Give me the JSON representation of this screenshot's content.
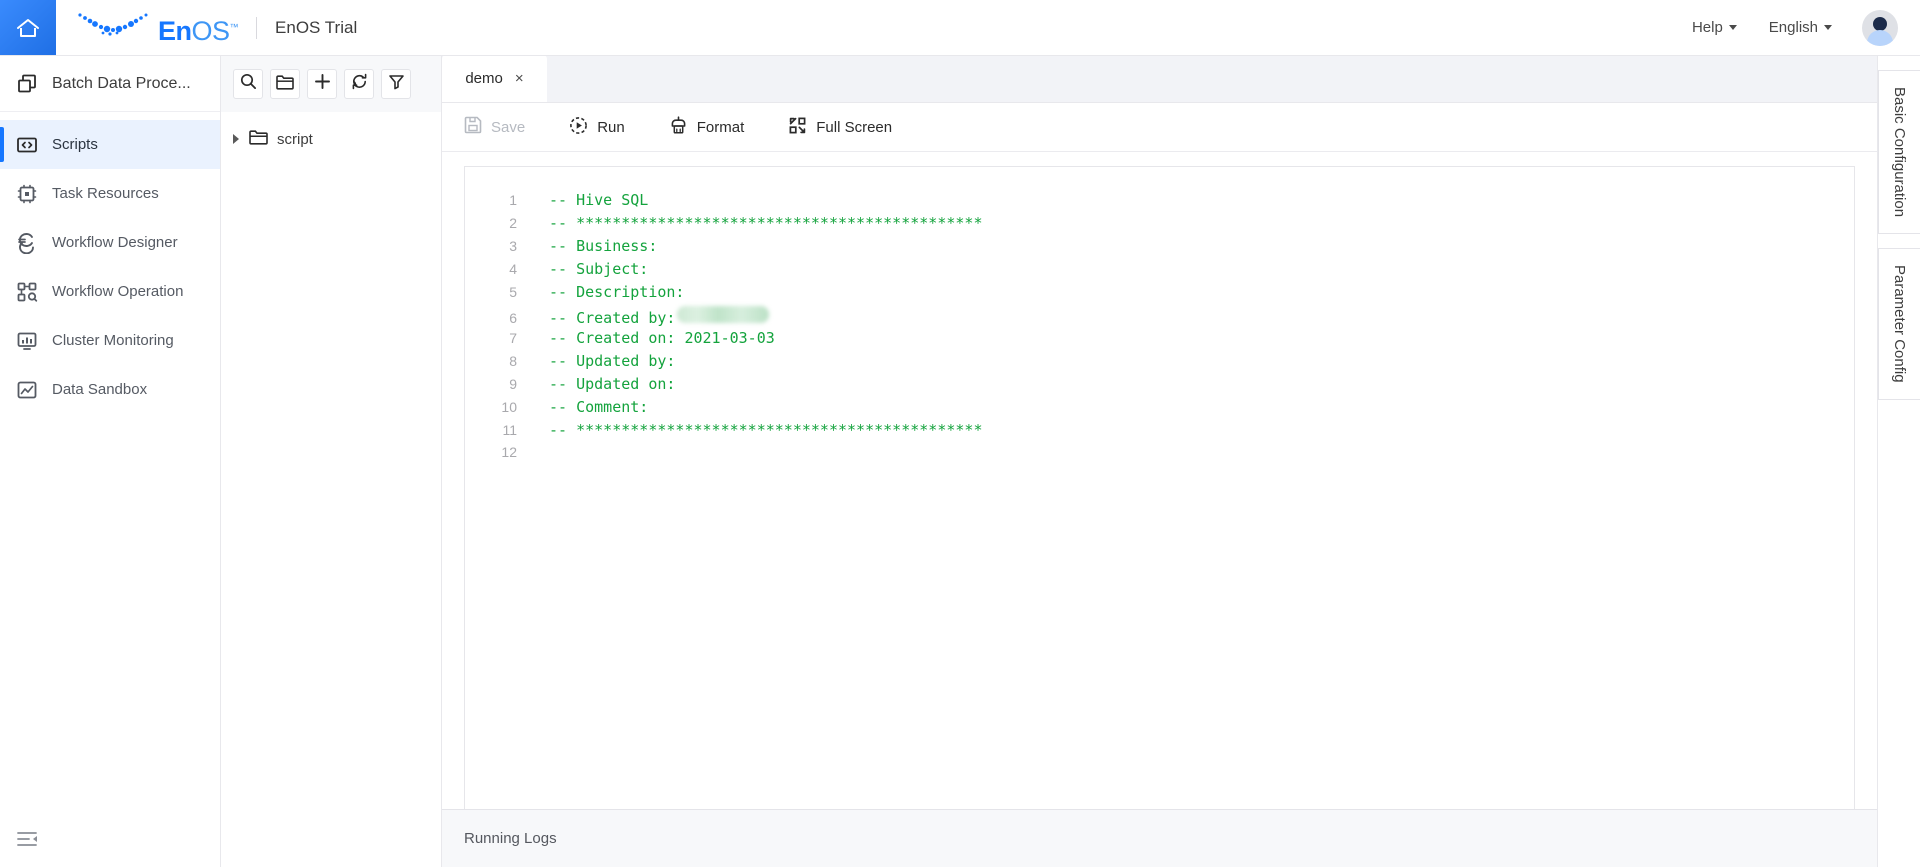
{
  "header": {
    "home_icon": "home-icon",
    "logo_en": "En",
    "logo_os": "OS",
    "logo_tm": "™",
    "product_title": "EnOS Trial",
    "help_label": "Help",
    "language_label": "English",
    "avatar": "user-avatar"
  },
  "sidebar": {
    "module_title": "Batch Data Proce...",
    "module_icon": "stack-icon",
    "collapse_icon": "collapse-sidebar-icon",
    "items": [
      {
        "label": "Scripts",
        "icon": "code-brackets-icon",
        "active": true
      },
      {
        "label": "Task Resources",
        "icon": "chip-icon",
        "active": false
      },
      {
        "label": "Workflow Designer",
        "icon": "flow-designer-icon",
        "active": false
      },
      {
        "label": "Workflow Operation",
        "icon": "flow-operation-icon",
        "active": false
      },
      {
        "label": "Cluster Monitoring",
        "icon": "monitor-chart-icon",
        "active": false
      },
      {
        "label": "Data Sandbox",
        "icon": "sandbox-icon",
        "active": false
      }
    ]
  },
  "tree": {
    "toolbar": [
      {
        "name": "search-icon",
        "title": "Search"
      },
      {
        "name": "folder-icon",
        "title": "New Folder"
      },
      {
        "name": "plus-icon",
        "title": "New"
      },
      {
        "name": "refresh-icon",
        "title": "Refresh"
      },
      {
        "name": "filter-icon",
        "title": "Filter"
      }
    ],
    "nodes": [
      {
        "label": "script",
        "expanded": false,
        "icon": "folder-icon"
      }
    ]
  },
  "editor": {
    "tabs": [
      {
        "label": "demo",
        "close": "×",
        "active": true
      }
    ],
    "toolbar": {
      "save_label": "Save",
      "save_icon": "save-icon",
      "save_disabled": true,
      "run_label": "Run",
      "run_icon": "run-icon",
      "format_label": "Format",
      "format_icon": "format-brush-icon",
      "fullscreen_label": "Full Screen",
      "fullscreen_icon": "fullscreen-icon"
    },
    "code_lines": [
      {
        "n": "1",
        "text": "-- Hive SQL"
      },
      {
        "n": "2",
        "text": "-- *********************************************"
      },
      {
        "n": "3",
        "text": "-- Business:"
      },
      {
        "n": "4",
        "text": "-- Subject:"
      },
      {
        "n": "5",
        "text": "-- Description:"
      },
      {
        "n": "6",
        "text": "-- Created by:",
        "redacted": true
      },
      {
        "n": "7",
        "text": "-- Created on: 2021-03-03"
      },
      {
        "n": "8",
        "text": "-- Updated by:"
      },
      {
        "n": "9",
        "text": "-- Updated on:"
      },
      {
        "n": "10",
        "text": "-- Comment:"
      },
      {
        "n": "11",
        "text": "-- *********************************************"
      },
      {
        "n": "12",
        "text": ""
      }
    ],
    "logs_label": "Running Logs"
  },
  "right_panel": {
    "tabs": [
      {
        "label": "Basic Configuration"
      },
      {
        "label": "Parameter Config"
      }
    ]
  },
  "colors": {
    "brand_blue": "#1677ff",
    "active_nav_bg": "#eaf2fe",
    "comment_green": "#14a33d",
    "toolbar_bg": "#f7f8fa"
  }
}
